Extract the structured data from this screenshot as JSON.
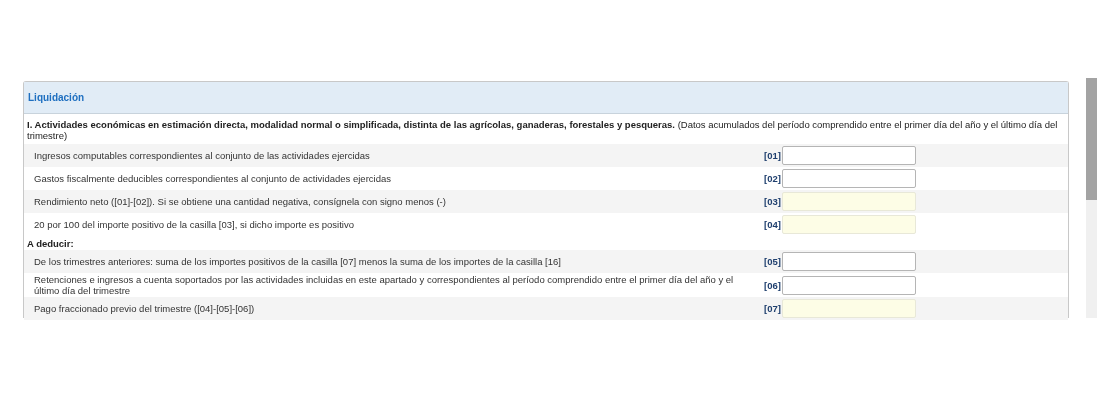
{
  "panel": {
    "title": "Liquidación"
  },
  "sections": [
    {
      "heading": "**I. Actividades económicas en estimación directa, modalidad normal o simplificada, distinta de las agrícolas, ganaderas, forestales y pesqueras.** (Datos acumulados del período comprendido entre el primer día del año y el último día del trimestre)",
      "kind": "intro",
      "rows": [
        {
          "label": "Ingresos computables correspondientes al conjunto de las actividades ejercidas",
          "code": "[01]",
          "kind": "input"
        },
        {
          "label": "Gastos fiscalmente deducibles correspondientes al conjunto de actividades ejercidas",
          "code": "[02]",
          "kind": "input"
        },
        {
          "label": "Rendimiento neto ([01]-[02]). Si se obtiene una cantidad negativa, consígnela con signo menos (-)",
          "code": "[03]",
          "kind": "computed"
        },
        {
          "label": "20 por 100 del importe positivo de la casilla [03], si dicho importe es positivo",
          "code": "[04]",
          "kind": "computed"
        }
      ]
    },
    {
      "heading": "A deducir:",
      "kind": "subheading",
      "rows": [
        {
          "label": "De los trimestres anteriores: suma de los importes positivos de la casilla [07] menos la suma de los importes de la casilla [16]",
          "code": "[05]",
          "kind": "input"
        },
        {
          "label": "Retenciones e ingresos a cuenta soportados por las actividades incluidas en este apartado y correspondientes al período comprendido entre el primer día del año y el último día del trimestre",
          "code": "[06]",
          "kind": "input"
        },
        {
          "label": "Pago fraccionado previo del trimestre ([04]-[05]-[06])",
          "code": "[07]",
          "kind": "computed"
        }
      ]
    }
  ]
}
